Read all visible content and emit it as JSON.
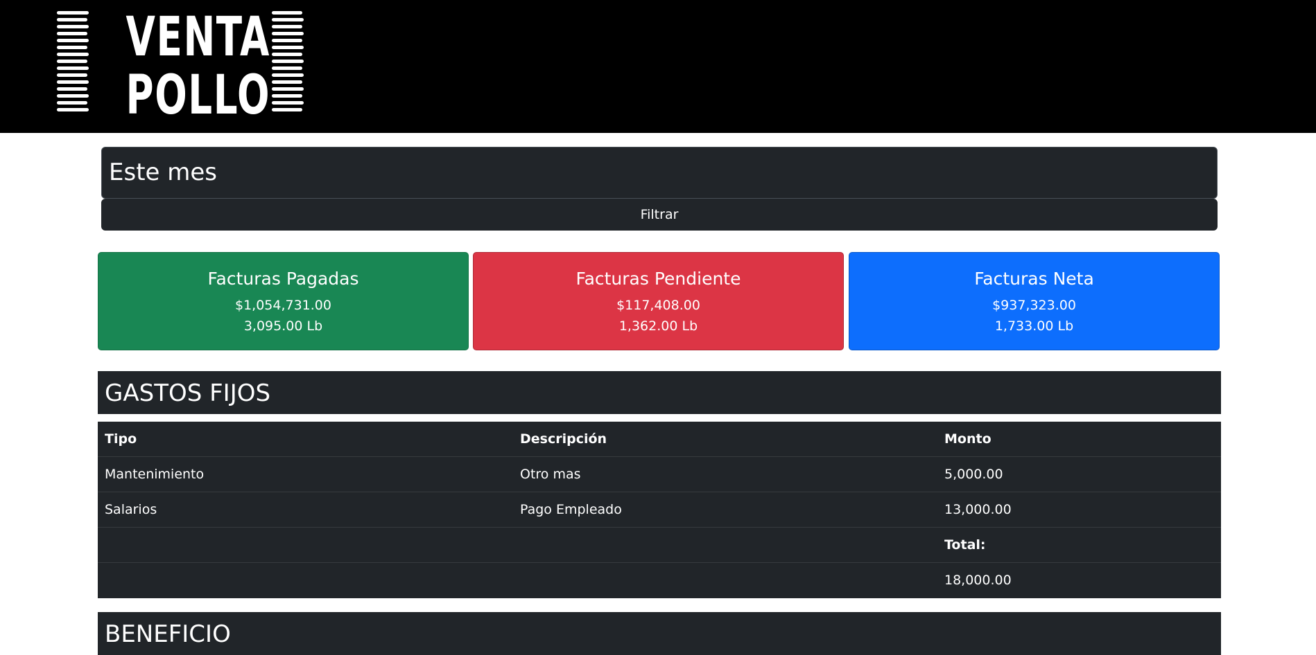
{
  "brand": {
    "logo_line1": "VENTA",
    "logo_line2": "POLLO"
  },
  "filter": {
    "value": "Este mes",
    "button_label": "Filtrar"
  },
  "summary_cards": [
    {
      "title": "Facturas Pagadas",
      "amount": "$1,054,731.00",
      "weight": "3,095.00 Lb",
      "color": "#198754"
    },
    {
      "title": "Facturas Pendiente",
      "amount": "$117,408.00",
      "weight": "1,362.00 Lb",
      "color": "#dc3545"
    },
    {
      "title": "Facturas Neta",
      "amount": "$937,323.00",
      "weight": "1,733.00 Lb",
      "color": "#0d6efd"
    }
  ],
  "gastos": {
    "title": "GASTOS FIJOS",
    "columns": [
      "Tipo",
      "Descripción",
      "Monto"
    ],
    "rows": [
      {
        "tipo": "Mantenimiento",
        "descripcion": "Otro mas",
        "monto": "5,000.00"
      },
      {
        "tipo": "Salarios",
        "descripcion": "Pago Empleado",
        "monto": "13,000.00"
      }
    ],
    "total_label": "Total:",
    "total_value": "18,000.00"
  },
  "beneficio": {
    "title": "BENEFICIO"
  },
  "colors": {
    "header_bg": "#000000",
    "dark_panel": "#212529",
    "success": "#198754",
    "danger": "#dc3545",
    "primary": "#0d6efd"
  }
}
